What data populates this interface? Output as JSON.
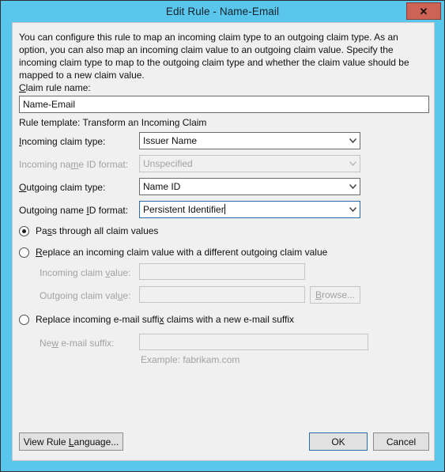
{
  "window": {
    "title": "Edit Rule - Name-Email",
    "close_label": "✕",
    "titlebar_color": "#5bc6ec",
    "close_button_color": "#cd6255"
  },
  "intro": {
    "text": "You can configure this rule to map an incoming claim type to an outgoing claim type. As an option, you can also map an incoming claim value to an outgoing claim value. Specify the incoming claim type to map to the outgoing claim type and whether the claim value should be mapped to a new claim value."
  },
  "fields": {
    "claim_rule_name": {
      "label_pre": "C",
      "label_post": "laim rule name:",
      "value": "Name-Email",
      "placeholder": ""
    },
    "rule_template": {
      "text": "Rule template: Transform an Incoming Claim"
    },
    "incoming_claim_type": {
      "label_pre": "I",
      "label_mid": "ncoming claim type:",
      "value": "Issuer Name",
      "enabled": true
    },
    "incoming_name_id_format": {
      "label_a": "Incoming na",
      "label_key": "m",
      "label_b": "e ID format:",
      "value": "Unspecified",
      "enabled": false
    },
    "outgoing_claim_type": {
      "label_pre": "O",
      "label_post": "utgoing claim type:",
      "value": "Name ID",
      "enabled": true
    },
    "outgoing_name_id_format": {
      "label_a": "Outgoing name ",
      "label_key": "I",
      "label_b": "D format:",
      "value": "Persistent Identifier",
      "enabled": true,
      "focused": true
    }
  },
  "options": {
    "pass_through": {
      "label_a": "Pa",
      "label_key": "s",
      "label_b": "s through all claim values",
      "selected": true
    },
    "replace_value": {
      "label_key": "R",
      "label_b": "eplace an incoming claim value with a different outgoing claim value",
      "selected": false
    },
    "incoming_claim_value": {
      "label_a": "Incoming claim ",
      "label_key": "v",
      "label_b": "alue:",
      "value": "",
      "enabled": false
    },
    "outgoing_claim_value": {
      "label_a": "Outgoing claim val",
      "label_key": "u",
      "label_b": "e:",
      "value": "",
      "enabled": false
    },
    "browse_button": {
      "label_key": "B",
      "label_b": "rowse...",
      "enabled": false
    },
    "replace_email_suffix": {
      "label_a": "Replace incoming e-mail suffi",
      "label_key": "x",
      "label_b": " claims with a new e-mail suffix",
      "selected": false
    },
    "new_email_suffix": {
      "label_a": "Ne",
      "label_key": "w",
      "label_b": " e-mail suffix:",
      "value": "",
      "enabled": false
    },
    "example_hint": {
      "text": "Example: fabrikam.com"
    }
  },
  "footer": {
    "view_rule_language": {
      "label_a": "View Rule ",
      "label_key": "L",
      "label_b": "anguage..."
    },
    "ok": {
      "label": "OK",
      "is_default": true
    },
    "cancel": {
      "label": "Cancel",
      "is_default": false
    }
  }
}
